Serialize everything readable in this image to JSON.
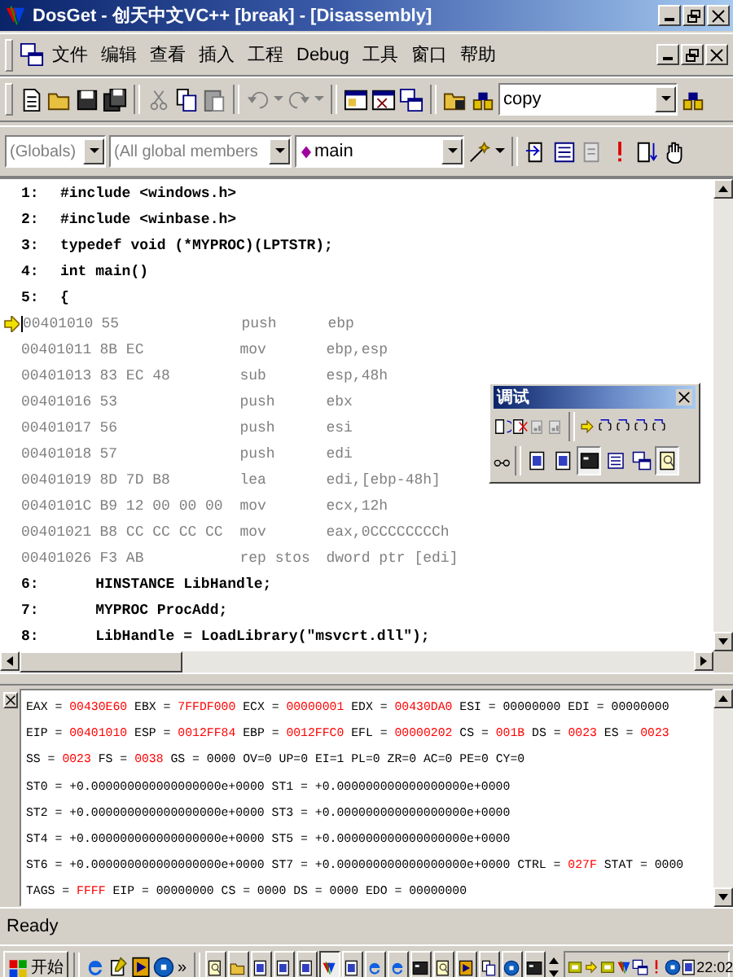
{
  "window": {
    "title": "DosGet - 创天中文VC++ [break] - [Disassembly]"
  },
  "menu": [
    "文件",
    "编辑",
    "查看",
    "插入",
    "工程",
    "Debug",
    "工具",
    "窗口",
    "帮助"
  ],
  "toolbar": {
    "find_combo": "copy"
  },
  "wizard_bar": {
    "class_combo": "(Globals)",
    "members_combo": "(All global members",
    "function_combo": "main"
  },
  "lines": [
    {
      "kind": "source",
      "number": "1:",
      "text": "#include <windows.h>",
      "current": false
    },
    {
      "kind": "source",
      "number": "2:",
      "text": "#include <winbase.h>",
      "current": false
    },
    {
      "kind": "source",
      "number": "3:",
      "text": "typedef void (*MYPROC)(LPTSTR);",
      "current": false
    },
    {
      "kind": "source",
      "number": "4:",
      "text": "int main()",
      "current": false
    },
    {
      "kind": "source",
      "number": "5:",
      "text": "{",
      "current": false
    },
    {
      "kind": "asm",
      "address": "00401010",
      "bytes": "55",
      "mnemonic": "push",
      "operands": "ebp",
      "current": true
    },
    {
      "kind": "asm",
      "address": "00401011",
      "bytes": "8B EC",
      "mnemonic": "mov",
      "operands": "ebp,esp",
      "current": false
    },
    {
      "kind": "asm",
      "address": "00401013",
      "bytes": "83 EC 48",
      "mnemonic": "sub",
      "operands": "esp,48h",
      "current": false
    },
    {
      "kind": "asm",
      "address": "00401016",
      "bytes": "53",
      "mnemonic": "push",
      "operands": "ebx",
      "current": false
    },
    {
      "kind": "asm",
      "address": "00401017",
      "bytes": "56",
      "mnemonic": "push",
      "operands": "esi",
      "current": false
    },
    {
      "kind": "asm",
      "address": "00401018",
      "bytes": "57",
      "mnemonic": "push",
      "operands": "edi",
      "current": false
    },
    {
      "kind": "asm",
      "address": "00401019",
      "bytes": "8D 7D B8",
      "mnemonic": "lea",
      "operands": "edi,[ebp-48h]",
      "current": false
    },
    {
      "kind": "asm",
      "address": "0040101C",
      "bytes": "B9 12 00 00 00",
      "mnemonic": "mov",
      "operands": "ecx,12h",
      "current": false
    },
    {
      "kind": "asm",
      "address": "00401021",
      "bytes": "B8 CC CC CC CC",
      "mnemonic": "mov",
      "operands": "eax,0CCCCCCCCh",
      "current": false
    },
    {
      "kind": "asm",
      "address": "00401026",
      "bytes": "F3 AB",
      "mnemonic": "rep stos",
      "operands": "dword ptr [edi]",
      "current": false
    },
    {
      "kind": "source",
      "number": "6:",
      "text": "    HINSTANCE LibHandle;",
      "current": false
    },
    {
      "kind": "source",
      "number": "7:",
      "text": "    MYPROC ProcAdd;",
      "current": false
    },
    {
      "kind": "source",
      "number": "8:",
      "text": "    LibHandle = LoadLibrary(\"msvcrt.dll\");",
      "current": false
    }
  ],
  "debug_toolbar": {
    "title": "调试",
    "window_buttons": [
      {
        "on": false
      },
      {
        "on": false
      },
      {
        "on": true
      },
      {
        "on": false
      },
      {
        "on": false
      },
      {
        "on": true
      }
    ]
  },
  "registers": [
    [
      {
        "text": "EAX = ",
        "changed": false
      },
      {
        "text": "00430E60",
        "changed": true
      },
      {
        "text": " EBX = ",
        "changed": false
      },
      {
        "text": "7FFDF000",
        "changed": true
      },
      {
        "text": " ECX = ",
        "changed": false
      },
      {
        "text": "00000001",
        "changed": true
      },
      {
        "text": " EDX = ",
        "changed": false
      },
      {
        "text": "00430DA0",
        "changed": true
      },
      {
        "text": " ESI = 00000000 EDI = 00000000",
        "changed": false
      }
    ],
    [
      {
        "text": "EIP = ",
        "changed": false
      },
      {
        "text": "00401010",
        "changed": true
      },
      {
        "text": " ESP = ",
        "changed": false
      },
      {
        "text": "0012FF84",
        "changed": true
      },
      {
        "text": " EBP = ",
        "changed": false
      },
      {
        "text": "0012FFC0",
        "changed": true
      },
      {
        "text": " EFL = ",
        "changed": false
      },
      {
        "text": "00000202",
        "changed": true
      },
      {
        "text": " CS = ",
        "changed": false
      },
      {
        "text": "001B",
        "changed": true
      },
      {
        "text": " DS = ",
        "changed": false
      },
      {
        "text": "0023",
        "changed": true
      },
      {
        "text": " ES = ",
        "changed": false
      },
      {
        "text": "0023",
        "changed": true
      }
    ],
    [
      {
        "text": "SS = ",
        "changed": false
      },
      {
        "text": "0023",
        "changed": true
      },
      {
        "text": " FS = ",
        "changed": false
      },
      {
        "text": "0038",
        "changed": true
      },
      {
        "text": " GS = 0000 OV=0 UP=0 EI=1 PL=0 ZR=0 AC=0 PE=0 CY=0",
        "changed": false
      }
    ],
    [
      {
        "text": "ST0 = +0.000000000000000000e+0000 ST1 = +0.000000000000000000e+0000",
        "changed": false
      }
    ],
    [
      {
        "text": "ST2 = +0.000000000000000000e+0000 ST3 = +0.000000000000000000e+0000",
        "changed": false
      }
    ],
    [
      {
        "text": "ST4 = +0.000000000000000000e+0000 ST5 = +0.000000000000000000e+0000",
        "changed": false
      }
    ],
    [
      {
        "text": "ST6 = +0.000000000000000000e+0000 ST7 = +0.000000000000000000e+0000 CTRL = ",
        "changed": false
      },
      {
        "text": "027F",
        "changed": true
      },
      {
        "text": " STAT = 0000",
        "changed": false
      }
    ],
    [
      {
        "text": "TAGS = ",
        "changed": false
      },
      {
        "text": "FFFF",
        "changed": true
      },
      {
        "text": " EIP = 00000000 CS = 0000 DS = 0000 EDO = 00000000",
        "changed": false
      }
    ]
  ],
  "status_bar": "Ready",
  "taskbar": {
    "start": "开始",
    "more": "»",
    "tasks": [
      {
        "selected": false
      },
      {
        "selected": false
      },
      {
        "selected": false
      },
      {
        "selected": false
      },
      {
        "selected": false
      },
      {
        "selected": true
      },
      {
        "selected": false
      },
      {
        "selected": false
      },
      {
        "selected": false
      },
      {
        "selected": false
      },
      {
        "selected": false
      },
      {
        "selected": false
      },
      {
        "selected": false
      },
      {
        "selected": false
      },
      {
        "selected": false
      }
    ],
    "clock": "22:02"
  }
}
